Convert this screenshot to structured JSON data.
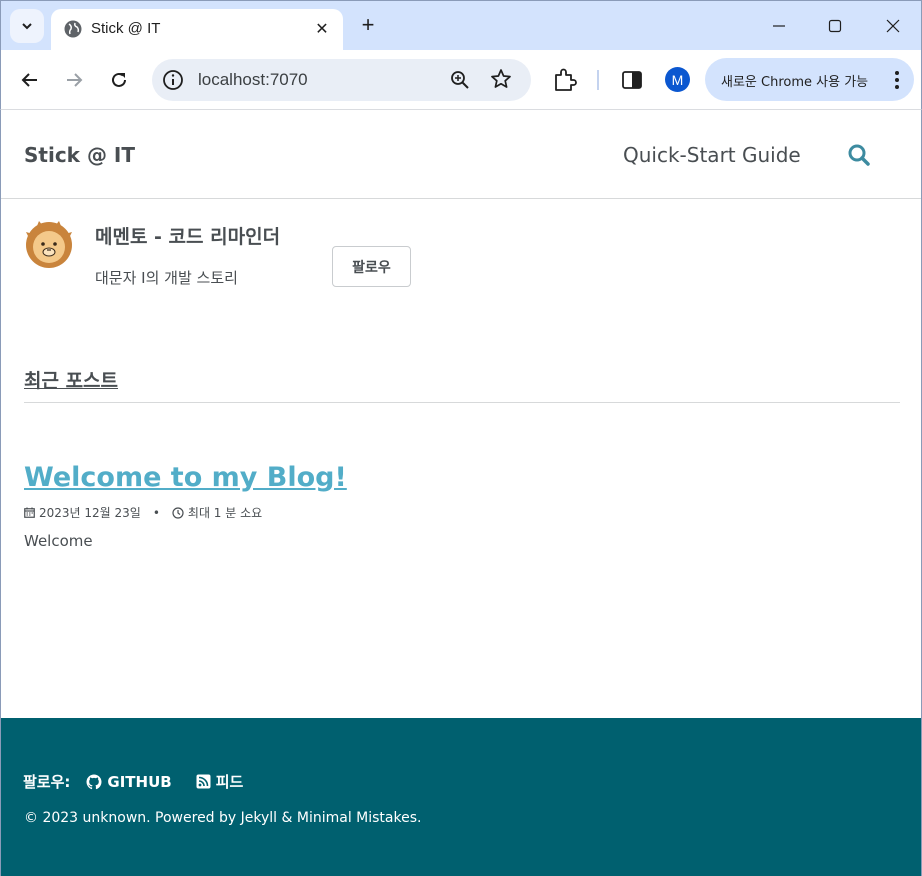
{
  "browser": {
    "tab_title": "Stick @ IT",
    "url": "localhost:7070",
    "profile_initial": "M",
    "update_button": "새로운 Chrome 사용 가능"
  },
  "site": {
    "title": "Stick @ IT",
    "nav": [
      "Quick-Start Guide"
    ]
  },
  "author": {
    "name": "메멘토 - 코드 리마인더",
    "bio": "대문자 I의 개발 스토리",
    "follow_label": "팔로우"
  },
  "recent": {
    "heading": "최근 포스트",
    "posts": [
      {
        "title": "Welcome to my Blog!",
        "date": "2023년 12월 23일",
        "read_time": "최대 1 분 소요",
        "excerpt": "Welcome"
      }
    ]
  },
  "footer": {
    "follow_label": "팔로우:",
    "links": [
      "GITHUB",
      "피드"
    ],
    "copyright": "© 2023 unknown. Powered by Jekyll & Minimal Mistakes."
  },
  "colors": {
    "accent_link": "#52adc8",
    "footer_bg": "#00606f",
    "text": "#494e52",
    "chrome_tabbar": "#d3e3fd"
  },
  "icons": [
    "tab-search-icon",
    "globe-icon",
    "close-icon",
    "new-tab-icon",
    "minimize-icon",
    "maximize-icon",
    "window-close-icon",
    "back-icon",
    "forward-icon",
    "reload-icon",
    "site-info-icon",
    "zoom-icon",
    "bookmark-star-icon",
    "extensions-icon",
    "side-panel-icon",
    "more-vert-icon",
    "search-icon",
    "calendar-icon",
    "clock-icon",
    "github-icon",
    "rss-icon"
  ]
}
